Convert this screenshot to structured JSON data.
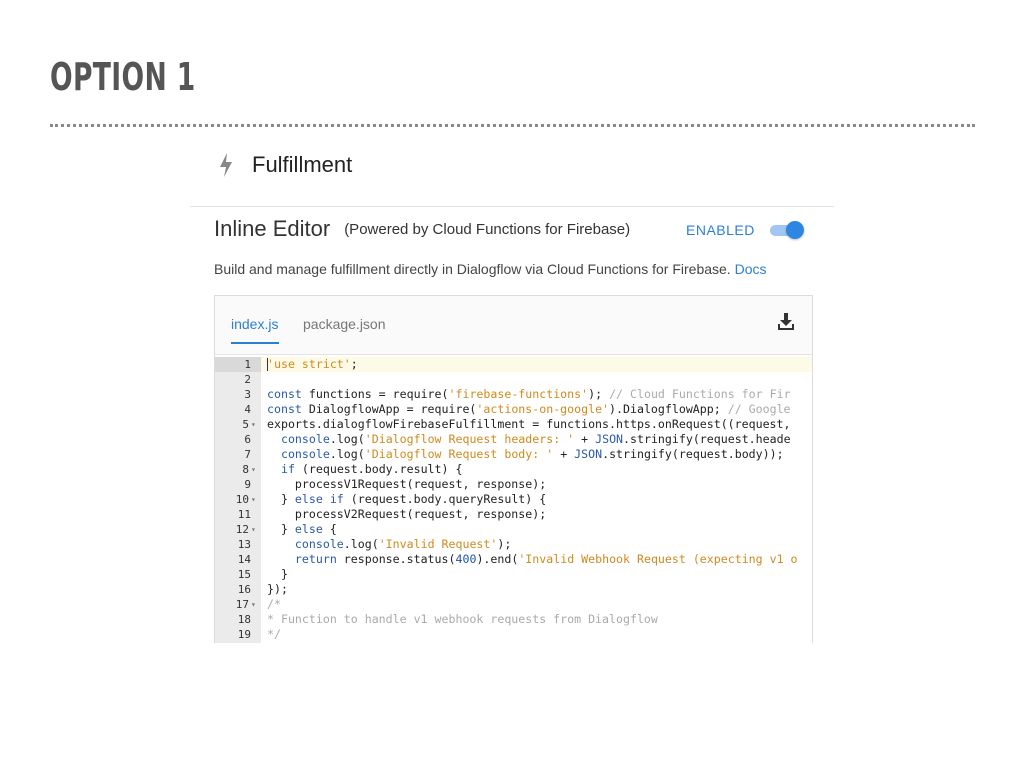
{
  "slide": {
    "title": "OPTION 1"
  },
  "header": {
    "title": "Fulfillment",
    "icon": "lightning-bolt-icon"
  },
  "inline_editor": {
    "title": "Inline Editor",
    "subtitle": "(Powered by Cloud Functions for Firebase)",
    "status_label": "ENABLED",
    "enabled": true,
    "description": "Build and manage fulfillment directly in Dialogflow via Cloud Functions for Firebase.",
    "docs_link": "Docs"
  },
  "editor": {
    "tabs": [
      {
        "label": "index.js",
        "active": true
      },
      {
        "label": "package.json",
        "active": false
      }
    ],
    "download_icon": "download-icon",
    "lines": [
      {
        "n": "1",
        "fold": false,
        "active": true,
        "tokens": [
          [
            "str",
            "'use strict'"
          ],
          [
            "plain",
            ";"
          ]
        ]
      },
      {
        "n": "2",
        "fold": false,
        "tokens": []
      },
      {
        "n": "3",
        "fold": false,
        "tokens": [
          [
            "kw",
            "const"
          ],
          [
            "plain",
            " functions = require("
          ],
          [
            "str",
            "'firebase-functions'"
          ],
          [
            "plain",
            "); "
          ],
          [
            "cm",
            "// Cloud Functions for Fir"
          ]
        ]
      },
      {
        "n": "4",
        "fold": false,
        "tokens": [
          [
            "kw",
            "const"
          ],
          [
            "plain",
            " DialogflowApp = require("
          ],
          [
            "str",
            "'actions-on-google'"
          ],
          [
            "plain",
            ").DialogflowApp; "
          ],
          [
            "cm",
            "// Google"
          ]
        ]
      },
      {
        "n": "5",
        "fold": true,
        "tokens": [
          [
            "plain",
            "exports.dialogflowFirebaseFulfillment = functions.https.onRequest((request,"
          ]
        ]
      },
      {
        "n": "6",
        "fold": false,
        "tokens": [
          [
            "plain",
            "  "
          ],
          [
            "fn",
            "console"
          ],
          [
            "plain",
            ".log("
          ],
          [
            "str",
            "'Dialogflow Request headers: '"
          ],
          [
            "plain",
            " + "
          ],
          [
            "fn",
            "JSON"
          ],
          [
            "plain",
            ".stringify(request.heade"
          ]
        ]
      },
      {
        "n": "7",
        "fold": false,
        "tokens": [
          [
            "plain",
            "  "
          ],
          [
            "fn",
            "console"
          ],
          [
            "plain",
            ".log("
          ],
          [
            "str",
            "'Dialogflow Request body: '"
          ],
          [
            "plain",
            " + "
          ],
          [
            "fn",
            "JSON"
          ],
          [
            "plain",
            ".stringify(request.body));"
          ]
        ]
      },
      {
        "n": "8",
        "fold": true,
        "tokens": [
          [
            "plain",
            "  "
          ],
          [
            "kw",
            "if"
          ],
          [
            "plain",
            " (request.body.result) {"
          ]
        ]
      },
      {
        "n": "9",
        "fold": false,
        "tokens": [
          [
            "plain",
            "    processV1Request(request, response);"
          ]
        ]
      },
      {
        "n": "10",
        "fold": true,
        "tokens": [
          [
            "plain",
            "  } "
          ],
          [
            "kw",
            "else if"
          ],
          [
            "plain",
            " (request.body.queryResult) {"
          ]
        ]
      },
      {
        "n": "11",
        "fold": false,
        "tokens": [
          [
            "plain",
            "    processV2Request(request, response);"
          ]
        ]
      },
      {
        "n": "12",
        "fold": true,
        "tokens": [
          [
            "plain",
            "  } "
          ],
          [
            "kw",
            "else"
          ],
          [
            "plain",
            " {"
          ]
        ]
      },
      {
        "n": "13",
        "fold": false,
        "tokens": [
          [
            "plain",
            "    "
          ],
          [
            "fn",
            "console"
          ],
          [
            "plain",
            ".log("
          ],
          [
            "str",
            "'Invalid Request'"
          ],
          [
            "plain",
            ");"
          ]
        ]
      },
      {
        "n": "14",
        "fold": false,
        "tokens": [
          [
            "plain",
            "    "
          ],
          [
            "kw",
            "return"
          ],
          [
            "plain",
            " response.status("
          ],
          [
            "num",
            "400"
          ],
          [
            "plain",
            ").end("
          ],
          [
            "str",
            "'Invalid Webhook Request (expecting v1 o"
          ]
        ]
      },
      {
        "n": "15",
        "fold": false,
        "tokens": [
          [
            "plain",
            "  }"
          ]
        ]
      },
      {
        "n": "16",
        "fold": false,
        "tokens": [
          [
            "plain",
            "});"
          ]
        ]
      },
      {
        "n": "17",
        "fold": true,
        "tokens": [
          [
            "cm",
            "/*"
          ]
        ]
      },
      {
        "n": "18",
        "fold": false,
        "tokens": [
          [
            "cm",
            "* Function to handle v1 webhook requests from Dialogflow"
          ]
        ]
      },
      {
        "n": "19",
        "fold": false,
        "tokens": [
          [
            "cm",
            "*/"
          ]
        ]
      }
    ]
  },
  "colors": {
    "accent": "#2e7fd2",
    "string": "#d08a1e",
    "keyword": "#2a5aa8",
    "comment": "#aaaaaa"
  }
}
